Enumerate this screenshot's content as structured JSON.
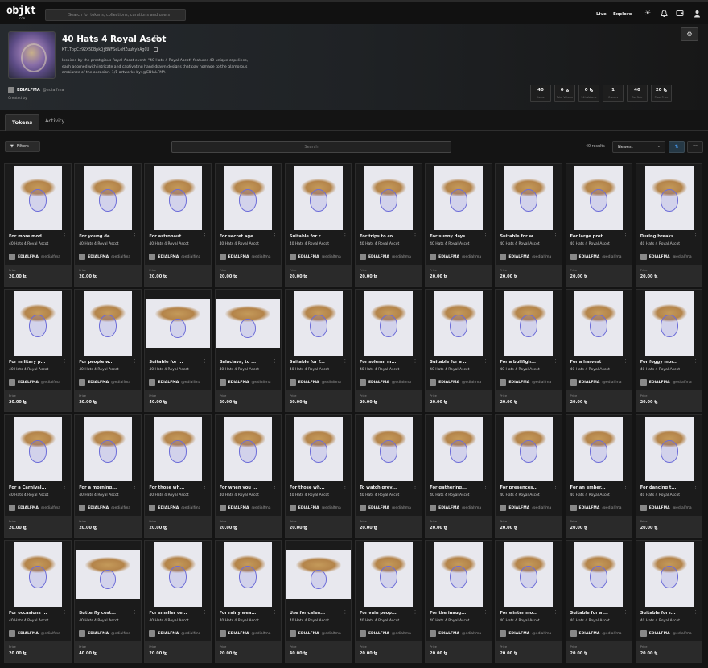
{
  "topbar": {
    "logo": "objkt",
    "logo_sub": ".com",
    "search_placeholder": "Search for tokens, collections, curations and users",
    "links": [
      "Live",
      "Explore"
    ]
  },
  "collection": {
    "title": "40 Hats 4 Royal Ascot",
    "address": "KT1TopCz92X5DBpkQjBWFSeLeHZuuWyhAgCU",
    "description": "Inspired by the prestigious Royal Ascot event, \"40 Hats 4 Royal Ascot\" features 40 unique capelines, each adorned with intricate and captivating hand-drawn designs that pay homage to the glamorous ambiance of the occasion. 1/1 artworks by: @EDIALFMA",
    "creator_name": "EDIALFMA",
    "creator_handle": "@edialfma",
    "creator_label": "Created by"
  },
  "stats": [
    {
      "value": "40",
      "label": "Items"
    },
    {
      "value": "0 ꜩ",
      "label": "Total Volume"
    },
    {
      "value": "0 ꜩ",
      "label": "24h Volume"
    },
    {
      "value": "1",
      "label": "Owners"
    },
    {
      "value": "40",
      "label": "For Sale"
    },
    {
      "value": "20 ꜩ",
      "label": "Floor Price"
    }
  ],
  "tabs": {
    "tokens": "Tokens",
    "activity": "Activity"
  },
  "toolbar": {
    "filters_label": "Filters",
    "search_placeholder": "Search",
    "results": "40 results",
    "sort": "Newest"
  },
  "card_common": {
    "collection": "40 Hats 4 Royal Ascot",
    "artist": "EDIALFMA",
    "handle": "@edialfma",
    "price_label": "Price",
    "more": "⋮"
  },
  "tokens": [
    {
      "title": "For more mod...",
      "price": "20.00 ꜩ"
    },
    {
      "title": "For young de...",
      "price": "20.00 ꜩ"
    },
    {
      "title": "For astronaut...",
      "price": "20.00 ꜩ"
    },
    {
      "title": "For secret age...",
      "price": "20.00 ꜩ"
    },
    {
      "title": "Suitable for r...",
      "price": "20.00 ꜩ"
    },
    {
      "title": "For trips to co...",
      "price": "20.00 ꜩ"
    },
    {
      "title": "For sunny days",
      "price": "20.00 ꜩ"
    },
    {
      "title": "Suitable for w...",
      "price": "20.00 ꜩ"
    },
    {
      "title": "For large prot...",
      "price": "20.00 ꜩ"
    },
    {
      "title": "During breaks...",
      "price": "20.00 ꜩ"
    },
    {
      "title": "For military p...",
      "price": "20.00 ꜩ"
    },
    {
      "title": "For people w...",
      "price": "20.00 ꜩ"
    },
    {
      "title": "Suitable for ...",
      "price": "40.00 ꜩ"
    },
    {
      "title": "Balaclava, to ...",
      "price": "20.00 ꜩ"
    },
    {
      "title": "Suitable for f...",
      "price": "20.00 ꜩ"
    },
    {
      "title": "For solemn m...",
      "price": "20.00 ꜩ"
    },
    {
      "title": "Suitable for a ...",
      "price": "20.00 ꜩ"
    },
    {
      "title": "For a bullfigh...",
      "price": "20.00 ꜩ"
    },
    {
      "title": "For a harvest",
      "price": "20.00 ꜩ"
    },
    {
      "title": "For foggy mor...",
      "price": "20.00 ꜩ"
    },
    {
      "title": "For a Carnival...",
      "price": "20.00 ꜩ"
    },
    {
      "title": "For a morning...",
      "price": "20.00 ꜩ"
    },
    {
      "title": "For those wh...",
      "price": "20.00 ꜩ"
    },
    {
      "title": "For when you ...",
      "price": "20.00 ꜩ"
    },
    {
      "title": "For those wh...",
      "price": "20.00 ꜩ"
    },
    {
      "title": "To watch grey...",
      "price": "20.00 ꜩ"
    },
    {
      "title": "For gathering...",
      "price": "20.00 ꜩ"
    },
    {
      "title": "For presences...",
      "price": "20.00 ꜩ"
    },
    {
      "title": "For an ember...",
      "price": "20.00 ꜩ"
    },
    {
      "title": "For dancing t...",
      "price": "20.00 ꜩ"
    },
    {
      "title": "For occasions ...",
      "price": "20.00 ꜩ"
    },
    {
      "title": "Butterfly cost...",
      "price": "40.00 ꜩ"
    },
    {
      "title": "For smaller ce...",
      "price": "20.00 ꜩ"
    },
    {
      "title": "For rainy wea...",
      "price": "20.00 ꜩ"
    },
    {
      "title": "Use for calen...",
      "price": "40.00 ꜩ"
    },
    {
      "title": "For vain peop...",
      "price": "20.00 ꜩ"
    },
    {
      "title": "For the inaug...",
      "price": "20.00 ꜩ"
    },
    {
      "title": "For winter mo...",
      "price": "20.00 ꜩ"
    },
    {
      "title": "Suitable for a ...",
      "price": "20.00 ꜩ"
    },
    {
      "title": "Suitable for r...",
      "price": "20.00 ꜩ"
    }
  ]
}
